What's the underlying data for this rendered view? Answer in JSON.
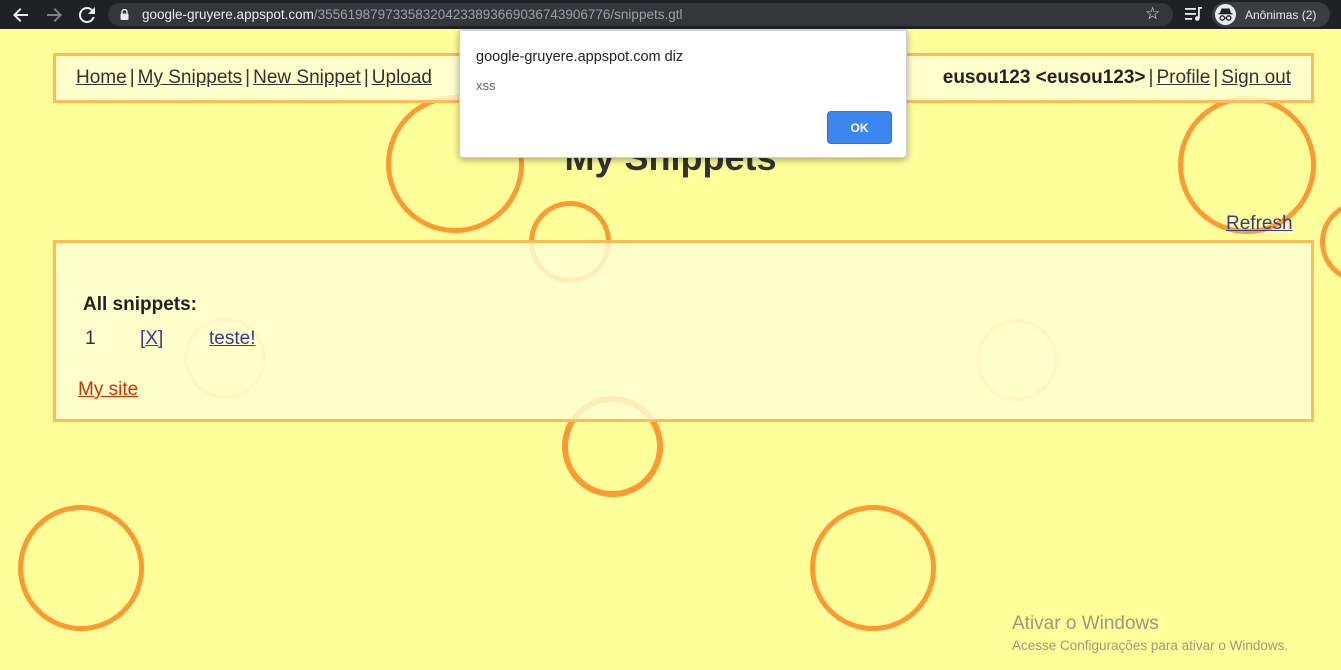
{
  "browser": {
    "url_host": "google-gruyere.appspot.com",
    "url_path": "/355619879733583204233893669036743906776/snippets.gtl",
    "profile_label": "Anônimas (2)",
    "back_icon": "arrow-back-icon",
    "forward_icon": "arrow-forward-icon",
    "reload_icon": "reload-icon",
    "bookmark_icon": "star-icon"
  },
  "menu": {
    "home": "Home",
    "my_snippets": "My Snippets",
    "new_snippet": "New Snippet",
    "upload": "Upload",
    "sep": "|",
    "user": "eusou123 <eusou123>",
    "profile": "Profile",
    "sign_out": "Sign out"
  },
  "page": {
    "title": "My Snippets",
    "refresh": "Refresh",
    "all_snippets_label": "All snippets:",
    "snippets": [
      {
        "index": "1",
        "delete_label": "[X]",
        "text": "teste!"
      }
    ],
    "my_site": "My site"
  },
  "dialog": {
    "title": "google-gruyere.appspot.com diz",
    "message": "xss",
    "ok": "OK"
  },
  "watermark": {
    "title": "Ativar o Windows",
    "subtitle": "Acesse Configurações para ativar o Windows."
  },
  "colors": {
    "page_background": "#ffff99",
    "border_orange": "#ffbb55",
    "bubble_orange": "#ff9933",
    "link_blue": "#3a3a90",
    "link_red": "#cc3300",
    "dialog_button": "#3b87f0"
  }
}
